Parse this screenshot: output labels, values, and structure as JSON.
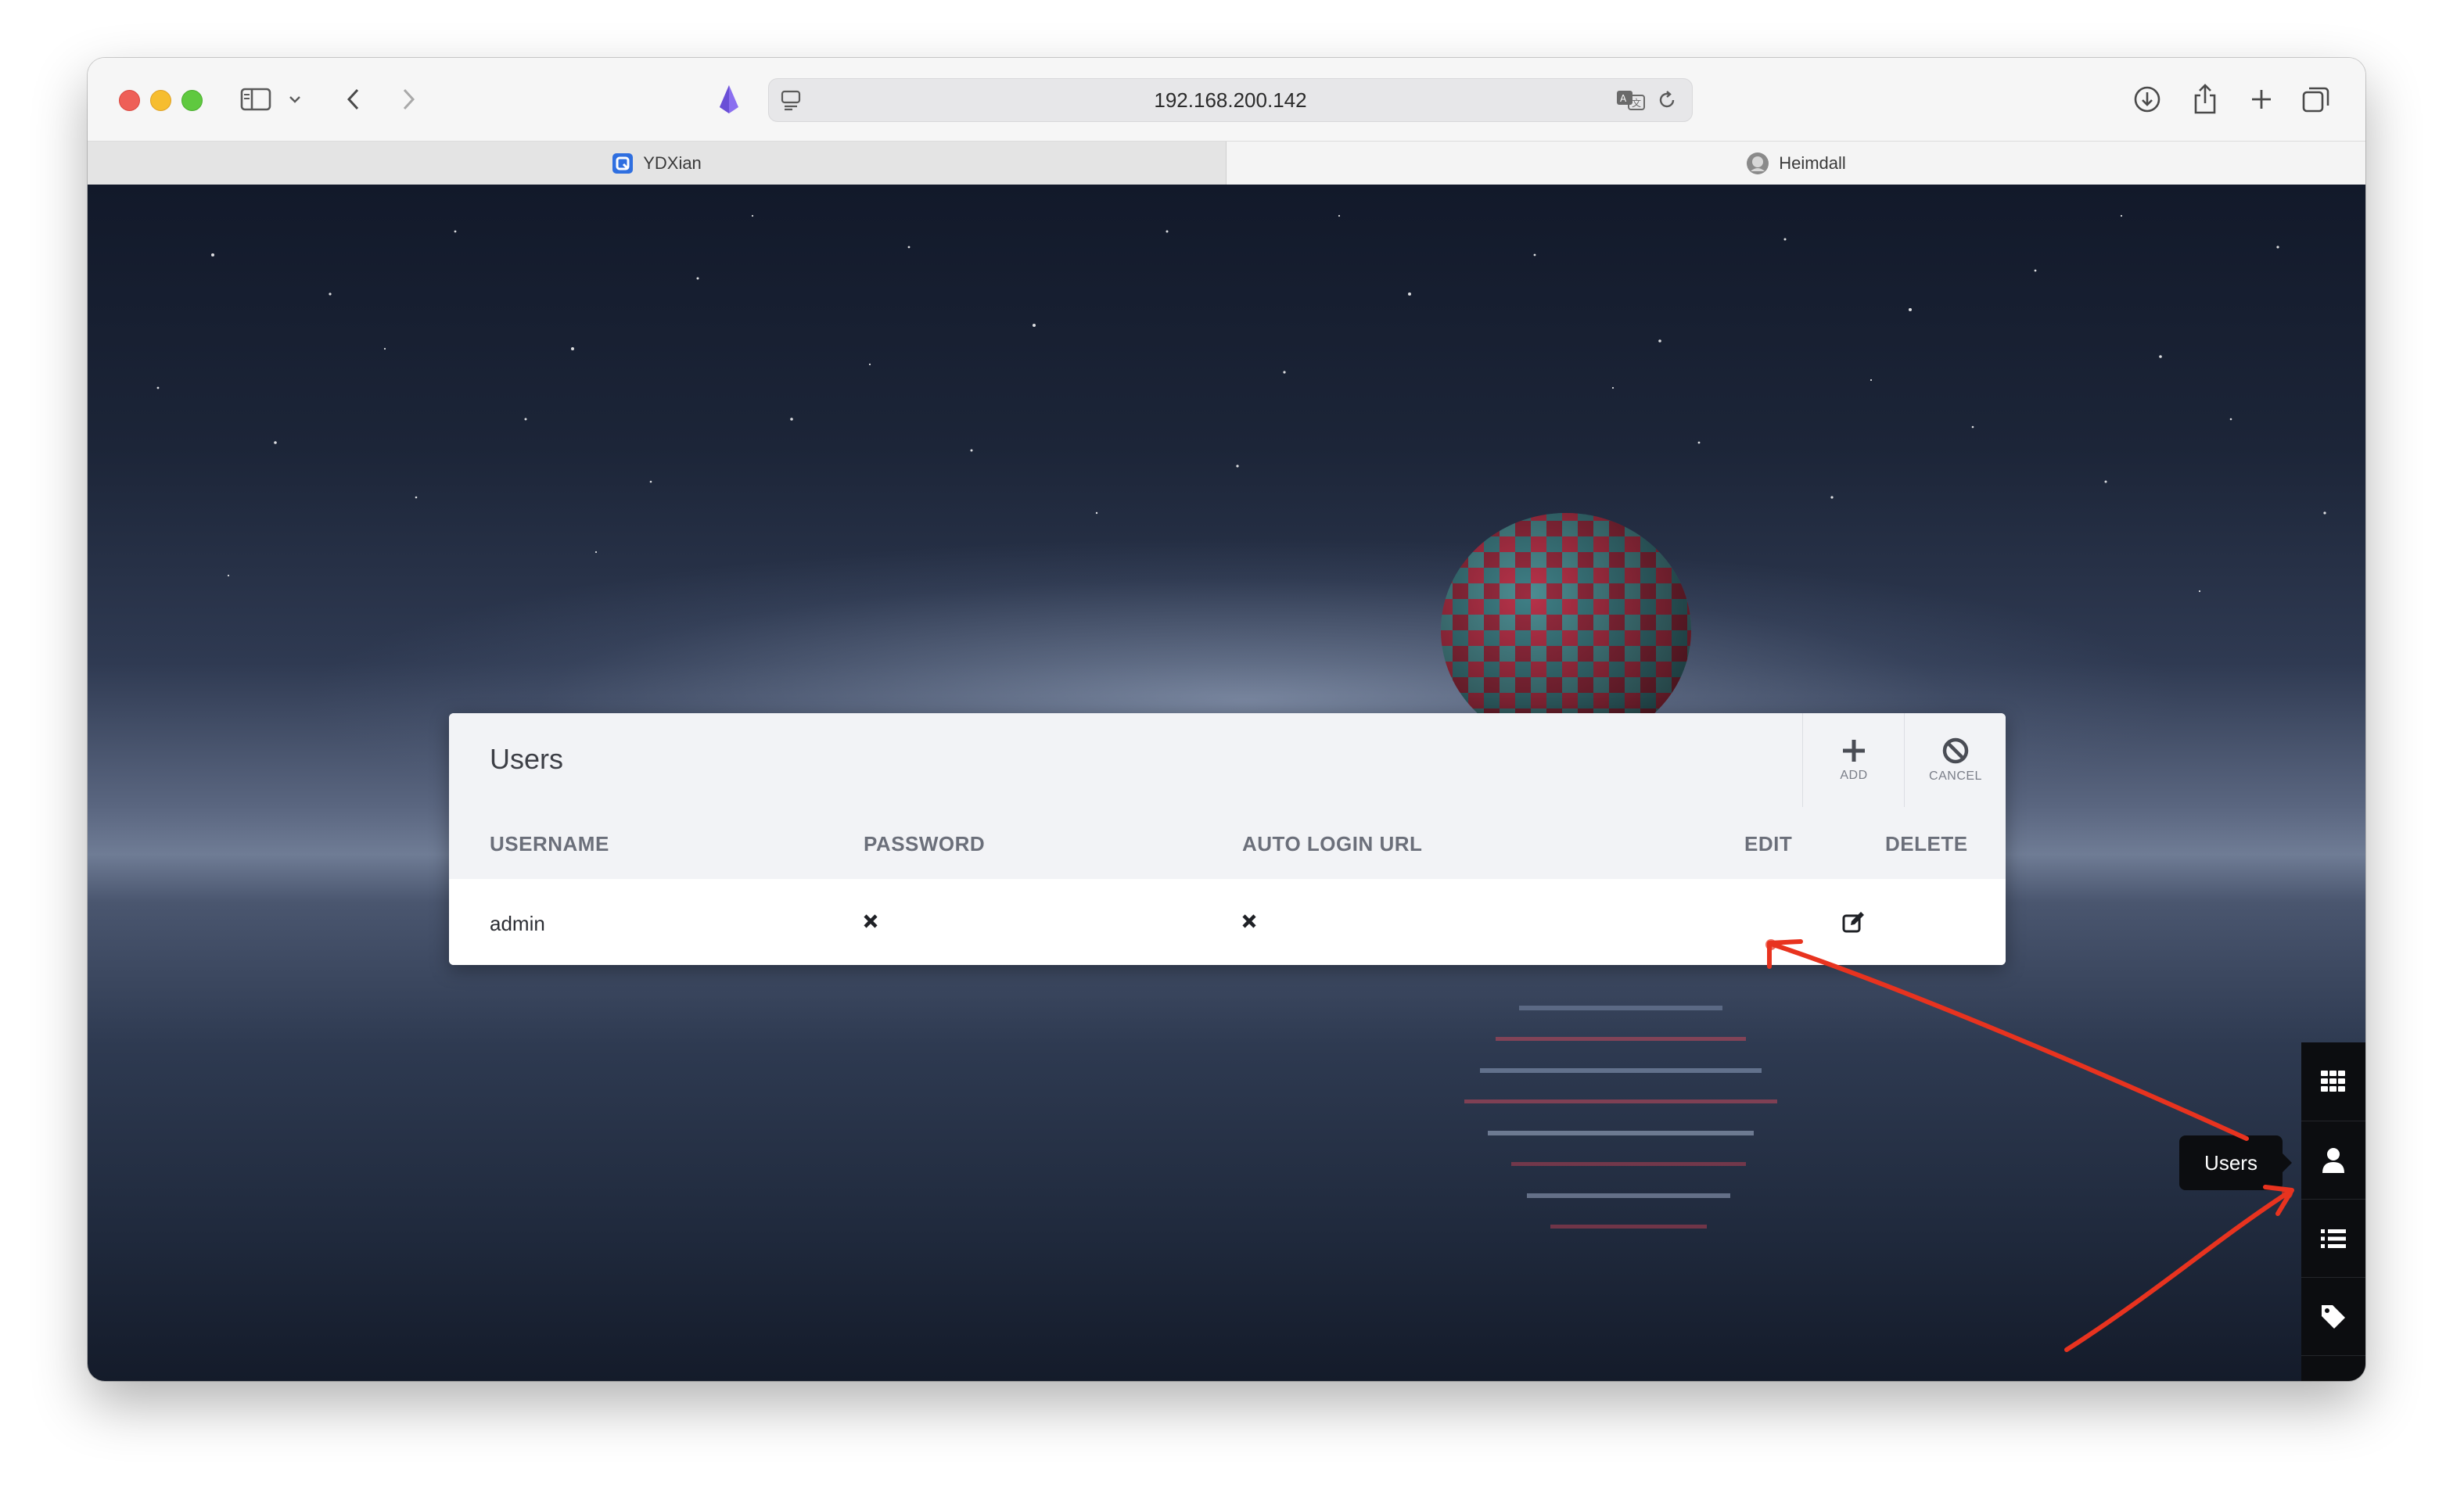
{
  "browser": {
    "url": "192.168.200.142",
    "tabs": [
      {
        "label": "YDXian",
        "active": true
      },
      {
        "label": "Heimdall",
        "active": false
      }
    ],
    "icons": [
      "sidebar-icon",
      "chevron-down-icon",
      "back-icon",
      "forward-icon",
      "shield-icon",
      "site-settings-icon",
      "translate-icon",
      "reload-icon",
      "download-icon",
      "share-icon",
      "new-tab-icon",
      "tab-overview-icon",
      "tab-close-icon"
    ]
  },
  "panel": {
    "title": "Users",
    "actions": {
      "add": "ADD",
      "cancel": "CANCEL"
    },
    "columns": {
      "username": "USERNAME",
      "password": "PASSWORD",
      "auto_login": "AUTO LOGIN URL",
      "edit": "EDIT",
      "delete": "DELETE"
    },
    "rows": [
      {
        "username": "admin",
        "password": "×",
        "auto_login": "×",
        "edit": "edit-icon",
        "delete": ""
      }
    ]
  },
  "sidebar": {
    "items": [
      {
        "name": "apps-grid-icon"
      },
      {
        "name": "users-icon",
        "tooltip": "Users"
      },
      {
        "name": "list-icon"
      },
      {
        "name": "tags-icon"
      },
      {
        "name": "settings-icon"
      }
    ],
    "tooltip": "Users"
  },
  "colors": {
    "annotation_arrow": "#e8331f",
    "sidebar_bg": "#0c0d10",
    "panel_header_bg": "#f2f3f6"
  }
}
